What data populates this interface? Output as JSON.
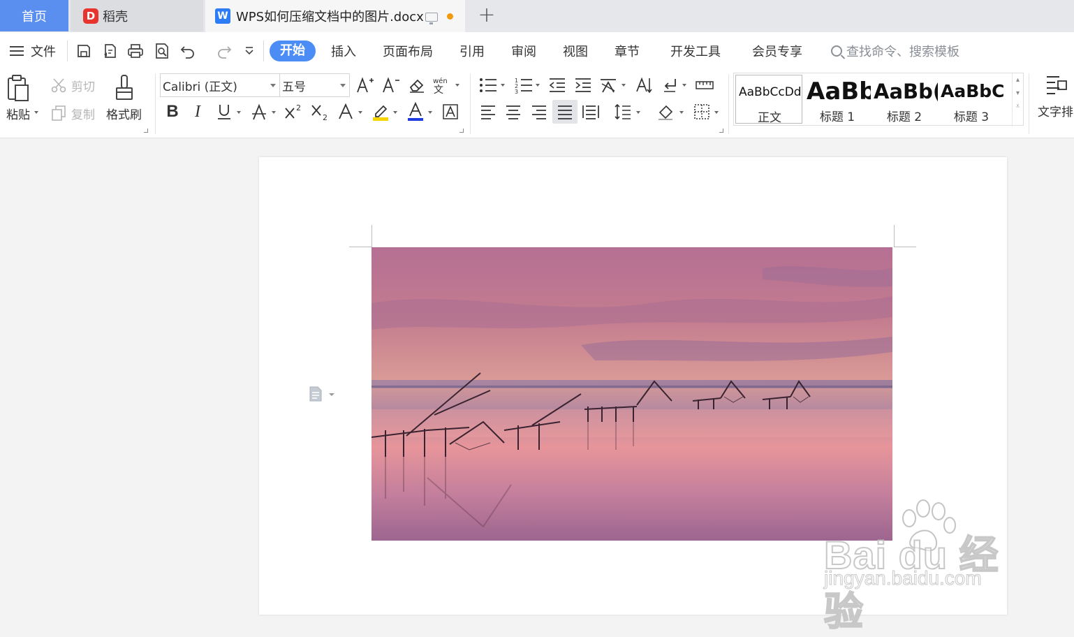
{
  "tabs": {
    "home": "首页",
    "daoke": "稻壳",
    "document": "WPS如何压缩文档中的图片.docx",
    "add": "+"
  },
  "menu": {
    "file": "文件",
    "items": [
      "开始",
      "插入",
      "页面布局",
      "引用",
      "审阅",
      "视图",
      "章节",
      "开发工具",
      "会员专享"
    ],
    "search_placeholder": "查找命令、搜索模板"
  },
  "ribbon": {
    "paste": "粘贴",
    "cut": "剪切",
    "copy": "复制",
    "format_painter": "格式刷",
    "font_name": "Calibri (正文)",
    "font_size": "五号",
    "text_layout": "文字排",
    "styles": [
      {
        "sample": "AaBbCcDd",
        "name": "正文"
      },
      {
        "sample": "AaBb",
        "name": "标题 1"
      },
      {
        "sample": "AaBb(",
        "name": "标题 2"
      },
      {
        "sample": "AaBbC(",
        "name": "标题 3"
      }
    ]
  },
  "watermark": {
    "line1": "Bai du 经验",
    "line2": "jingyan.baidu.com"
  },
  "colors": {
    "accent": "#4b8cf5",
    "home_tab": "#5a8ff0",
    "highlight": "#f5d400",
    "font_color": "#1f3ce0"
  },
  "icons": [
    "save-icon",
    "export-pdf-icon",
    "print-icon",
    "print-preview-icon",
    "undo-icon",
    "redo-icon",
    "search-icon"
  ]
}
